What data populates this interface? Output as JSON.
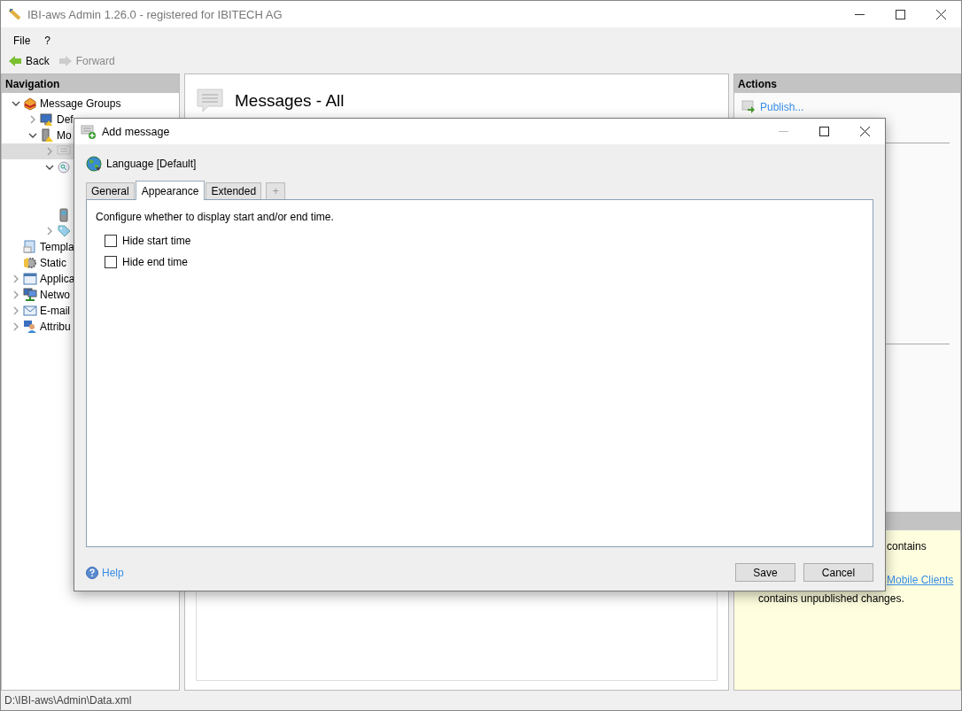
{
  "window": {
    "title": "IBI-aws Admin 1.26.0 - registered for IBITECH AG"
  },
  "menu": [
    "File",
    "?"
  ],
  "toolbar": [
    {
      "label": "Back",
      "disabled": false
    },
    {
      "label": "Forward",
      "disabled": true
    }
  ],
  "navigation": {
    "title": "Navigation",
    "tree": [
      {
        "label": "Message Groups",
        "expanded": true,
        "selected": false,
        "children": [
          {
            "label": "Def",
            "expanded": false,
            "selected": false
          },
          {
            "label": "Mo",
            "expanded": true,
            "selected": false,
            "children": [
              {
                "expanded": false,
                "selected": true
              },
              {
                "expanded": true,
                "selected": false
              },
              {
                "selected": false
              },
              {
                "expanded": false,
                "selected": false
              }
            ]
          }
        ]
      },
      {
        "label": "Templa",
        "selected": false
      },
      {
        "label": "Static",
        "selected": false
      },
      {
        "label": "Applica",
        "expanded": false,
        "selected": false
      },
      {
        "label": "Netwo",
        "expanded": false,
        "selected": false
      },
      {
        "label": "E-mail",
        "expanded": false,
        "selected": false
      },
      {
        "label": "Attribu",
        "expanded": false,
        "selected": false
      }
    ]
  },
  "content": {
    "title": "Messages - All"
  },
  "actions": {
    "title": "Actions",
    "items": [
      "Publish..."
    ]
  },
  "info": {
    "lines": [
      {
        "kind": "text",
        "text": "contains"
      },
      {
        "kind": "link",
        "text": "Mobile Clients"
      },
      {
        "kind": "text",
        "text": "contains unpublished changes."
      }
    ]
  },
  "status_bar": "D:\\IBI-aws\\Admin\\Data.xml",
  "dialog": {
    "title": "Add message",
    "language": "Language [Default]",
    "tabs": [
      {
        "label": "General",
        "selected": false
      },
      {
        "label": "Appearance",
        "selected": true
      },
      {
        "label": "Extended",
        "selected": false
      },
      {
        "label": "+",
        "selected": false
      }
    ],
    "description": "Configure whether to display start and/or end time.",
    "options": [
      {
        "label": "Hide start time",
        "checked": false
      },
      {
        "label": "Hide end time",
        "checked": false
      }
    ],
    "help": "Help",
    "buttons": [
      "Save",
      "Cancel"
    ]
  }
}
